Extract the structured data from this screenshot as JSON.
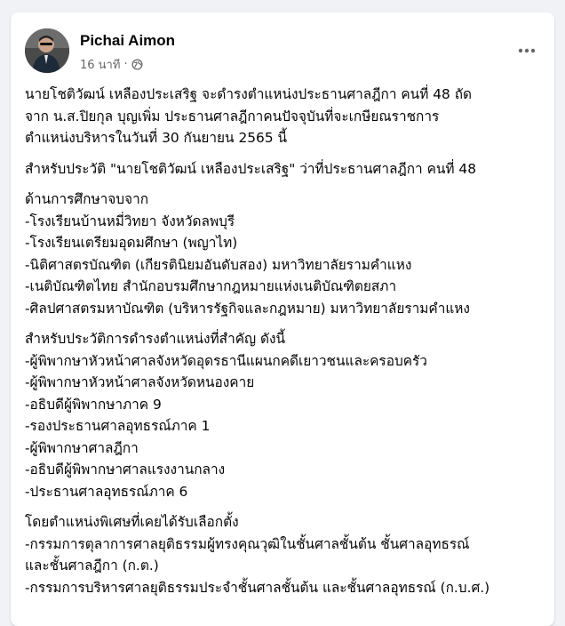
{
  "post": {
    "author": "Pichai Aimon",
    "time": "16 นาที",
    "separator": "·",
    "privacy_icon": "globe-icon",
    "more_icon": "more-horizontal-icon"
  },
  "body": {
    "intro": [
      "นายโชติวัฒน์ เหลืองประเสริฐ จะดำรงตำแหน่งประธานศาลฎีกา คนที่ 48 ถัด",
      "จาก น.ส.ปิยกุล บุญเพิ่ม ประธานศาลฎีกาคนปัจจุบันที่จะเกษียณราชการ",
      "ตำแหน่งบริหารในวันที่ 30 กันยายน 2565 นี้"
    ],
    "bio_title": "สำหรับประวัติ \"นายโชติวัฒน์ เหลืองประเสริฐ\" ว่าที่ประธานศาลฎีกา คนที่ 48",
    "education": [
      "ด้านการศึกษาจบจาก",
      "-โรงเรียนบ้านหมี่วิทยา จังหวัดลพบุรี",
      "-โรงเรียนเตรียมอุดมศึกษา (พญาไท)",
      "-นิติศาสตรบัณฑิต (เกียรตินิยมอันดับสอง) มหาวิทยาลัยรามคำแหง",
      "-เนติบัณฑิตไทย สำนักอบรมศึกษากฎหมายแห่งเนติบัณฑิตยสภา",
      "-ศิลปศาสตรมหาบัณฑิต (บริหารรัฐกิจและกฎหมาย) มหาวิทยาลัยรามคำแหง"
    ],
    "positions": [
      "สำหรับประวัติการดำรงตำแหน่งที่สำคัญ ดังนี้",
      "-ผู้พิพากษาหัวหน้าศาลจังหวัดอุดรธานีแผนกคดีเยาวชนและครอบครัว",
      "-ผู้พิพากษาหัวหน้าศาลจังหวัดหนองคาย",
      "-อธิบดีผู้พิพากษาภาค 9",
      "-รองประธานศาลอุทธรณ์ภาค 1",
      "-ผู้พิพากษาศาลฎีกา",
      "-อธิบดีผู้พิพากษาศาลแรงงานกลาง",
      "-ประธานศาลอุทธรณ์ภาค 6"
    ],
    "special": [
      "โดยตำแหน่งพิเศษที่เคยได้รับเลือกตั้ง",
      "-กรรมการตุลาการศาลยุติธรรมผู้ทรงคุณวุฒิในชั้นศาลชั้นต้น ชั้นศาลอุทธรณ์",
      "และชั้นศาลฎีกา (ก.ต.)",
      "-กรรมการบริหารศาลยุติธรรมประจำชั้นศาลชั้นต้น และชั้นศาลอุทธรณ์ (ก.บ.ศ.)"
    ]
  }
}
